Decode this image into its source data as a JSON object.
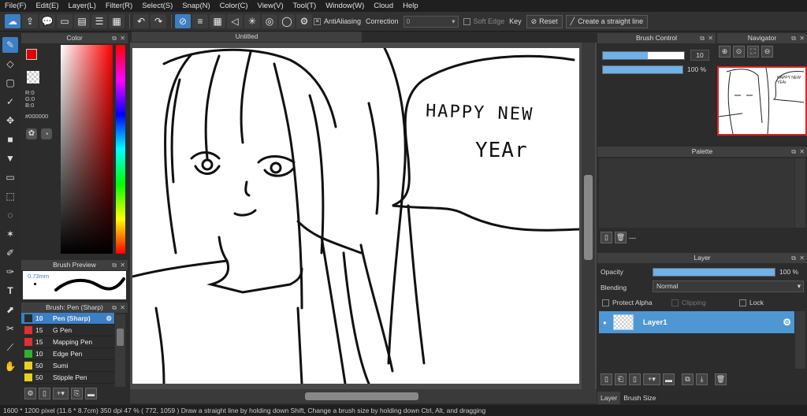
{
  "menu": [
    "File(F)",
    "Edit(E)",
    "Layer(L)",
    "Filter(R)",
    "Select(S)",
    "Snap(N)",
    "Color(C)",
    "View(V)",
    "Tool(T)",
    "Window(W)",
    "Cloud",
    "Help"
  ],
  "toolbar": {
    "antialiasing": "AntiAliasing",
    "correction_label": "Correction",
    "correction_value": "0",
    "soft_edge": "Soft Edge",
    "key": "Key",
    "reset": "Reset",
    "straight": "Create a straight line"
  },
  "color_panel": {
    "title": "Color",
    "r": "R:0",
    "g": "G:0",
    "b": "B:0",
    "hex": "#000000",
    "primary": "#e00000",
    "secondary": "#000000"
  },
  "brush_preview": {
    "title": "Brush Preview",
    "size": "0.73mm"
  },
  "brush_panel": {
    "title": "Brush: Pen (Sharp)",
    "items": [
      {
        "size": "10",
        "name": "Pen (Sharp)",
        "color": "#2a2a2a",
        "selected": true
      },
      {
        "size": "15",
        "name": "G Pen",
        "color": "#e03030"
      },
      {
        "size": "15",
        "name": "Mapping Pen",
        "color": "#e03030"
      },
      {
        "size": "10",
        "name": "Edge Pen",
        "color": "#30b030"
      },
      {
        "size": "50",
        "name": "Sumi",
        "color": "#e8d020"
      },
      {
        "size": "50",
        "name": "Stipple Pen",
        "color": "#e8d020"
      }
    ]
  },
  "document": {
    "tab": "Untitled",
    "bubble_text_1": "HAPPY NEW",
    "bubble_text_2": "YEAr"
  },
  "brush_control": {
    "title": "Brush Control",
    "size": "10",
    "size_fill": 0.55,
    "opacity": "100 %",
    "opacity_fill": 1.0
  },
  "navigator": {
    "title": "Navigator",
    "thumb_text": "HAPPY NEW YEAr"
  },
  "palette": {
    "title": "Palette",
    "dashes": "---"
  },
  "layer": {
    "title": "Layer",
    "opacity_label": "Opacity",
    "opacity_value": "100 %",
    "opacity_fill": 1.0,
    "blending_label": "Blending",
    "blending_value": "Normal",
    "protect_alpha": "Protect Alpha",
    "clipping": "Clipping",
    "lock": "Lock",
    "layer_name": "Layer1"
  },
  "bottom_tabs": [
    "Layer",
    "Brush Size"
  ],
  "status": "1600 * 1200 pixel   (11.6 * 8.7cm)   350 dpi   47 %   ( 772, 1059 )   Draw a straight line by holding down Shift, Change a brush size by holding down Ctrl, Alt, and dragging"
}
